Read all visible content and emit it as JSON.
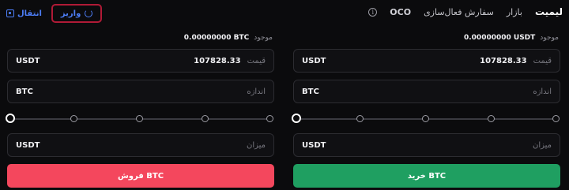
{
  "header": {
    "transfer_label": "انتقال",
    "deposit_label": "واریز",
    "tabs": [
      {
        "label": "لیمیت",
        "active": true
      },
      {
        "label": "بازار",
        "active": false
      },
      {
        "label": "سفارش فعال‌سازی",
        "active": false
      },
      {
        "label": "OCO",
        "active": false
      }
    ],
    "info_glyph": "i"
  },
  "buy": {
    "available_label": "موجود",
    "available_value": "0.00000000 USDT",
    "price": {
      "label": "قیمت",
      "value": "107828.33",
      "unit": "USDT"
    },
    "size": {
      "label": "اندازه",
      "value": "",
      "unit": "BTC"
    },
    "slider_level_percent": 0,
    "amount": {
      "label": "میزان",
      "value": "",
      "unit": "USDT"
    },
    "button_label": "خرید BTC",
    "color": "#1f9f61"
  },
  "sell": {
    "available_label": "موجود",
    "available_value": "0.00000000 BTC",
    "price": {
      "label": "قیمت",
      "value": "107828.33",
      "unit": "USDT"
    },
    "size": {
      "label": "اندازه",
      "value": "",
      "unit": "BTC"
    },
    "slider_level_percent": 0,
    "amount": {
      "label": "میزان",
      "value": "",
      "unit": "USDT"
    },
    "button_label": "فروش BTC",
    "color": "#f4475d"
  },
  "colors": {
    "accent_blue": "#4d7ef7",
    "highlight_border": "#b01a36",
    "background": "#0b0b0d"
  }
}
